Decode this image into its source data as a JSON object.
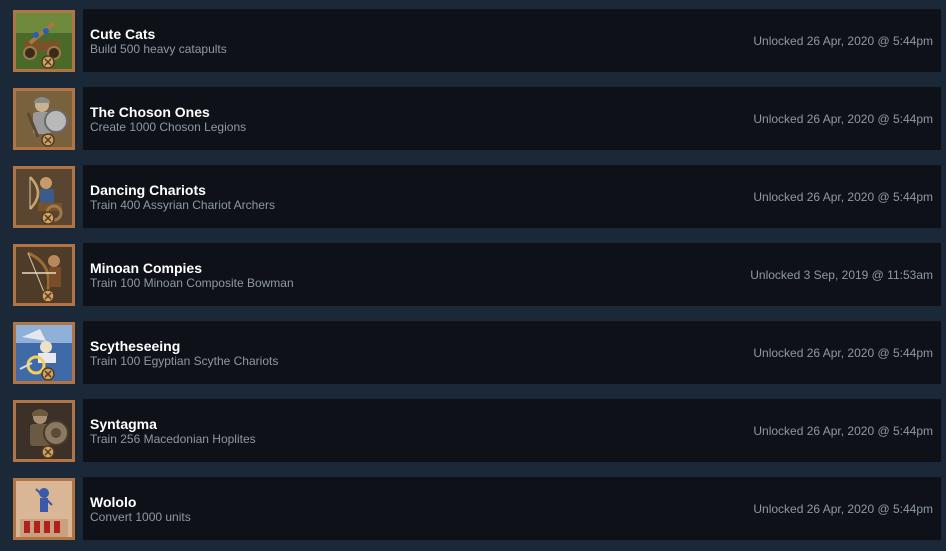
{
  "achievements": [
    {
      "title": "Cute Cats",
      "description": "Build 500 heavy catapults",
      "unlocked": "Unlocked 26 Apr, 2020 @ 5:44pm",
      "icon": "catapult-icon",
      "icon_bg": "#4a6a2a"
    },
    {
      "title": "The Choson Ones",
      "description": "Create 1000 Choson Legions",
      "unlocked": "Unlocked 26 Apr, 2020 @ 5:44pm",
      "icon": "legion-soldier-icon",
      "icon_bg": "#6a5434"
    },
    {
      "title": "Dancing Chariots",
      "description": "Train 400 Assyrian Chariot Archers",
      "unlocked": "Unlocked 26 Apr, 2020 @ 5:44pm",
      "icon": "chariot-archer-icon",
      "icon_bg": "#5a4630"
    },
    {
      "title": "Minoan Compies",
      "description": "Train 100 Minoan Composite Bowman",
      "unlocked": "Unlocked 3 Sep, 2019 @ 11:53am",
      "icon": "bowman-icon",
      "icon_bg": "#4e3b28"
    },
    {
      "title": "Scytheseeing",
      "description": "Train 100 Egyptian Scythe Chariots",
      "unlocked": "Unlocked 26 Apr, 2020 @ 5:44pm",
      "icon": "scythe-chariot-icon",
      "icon_bg": "#3f6aa8"
    },
    {
      "title": "Syntagma",
      "description": "Train 256 Macedonian Hoplites",
      "unlocked": "Unlocked 26 Apr, 2020 @ 5:44pm",
      "icon": "hoplite-icon",
      "icon_bg": "#3b3128"
    },
    {
      "title": "Wololo",
      "description": "Convert 1000 units",
      "unlocked": "Unlocked 26 Apr, 2020 @ 5:44pm",
      "icon": "priest-convert-icon",
      "icon_bg": "#d9b796"
    }
  ],
  "colors": {
    "page_bg": "#1b2838",
    "panel_bg": "#0e1218",
    "icon_frame": "#b07445",
    "title": "#ffffff",
    "muted_text": "#8f98a0"
  }
}
